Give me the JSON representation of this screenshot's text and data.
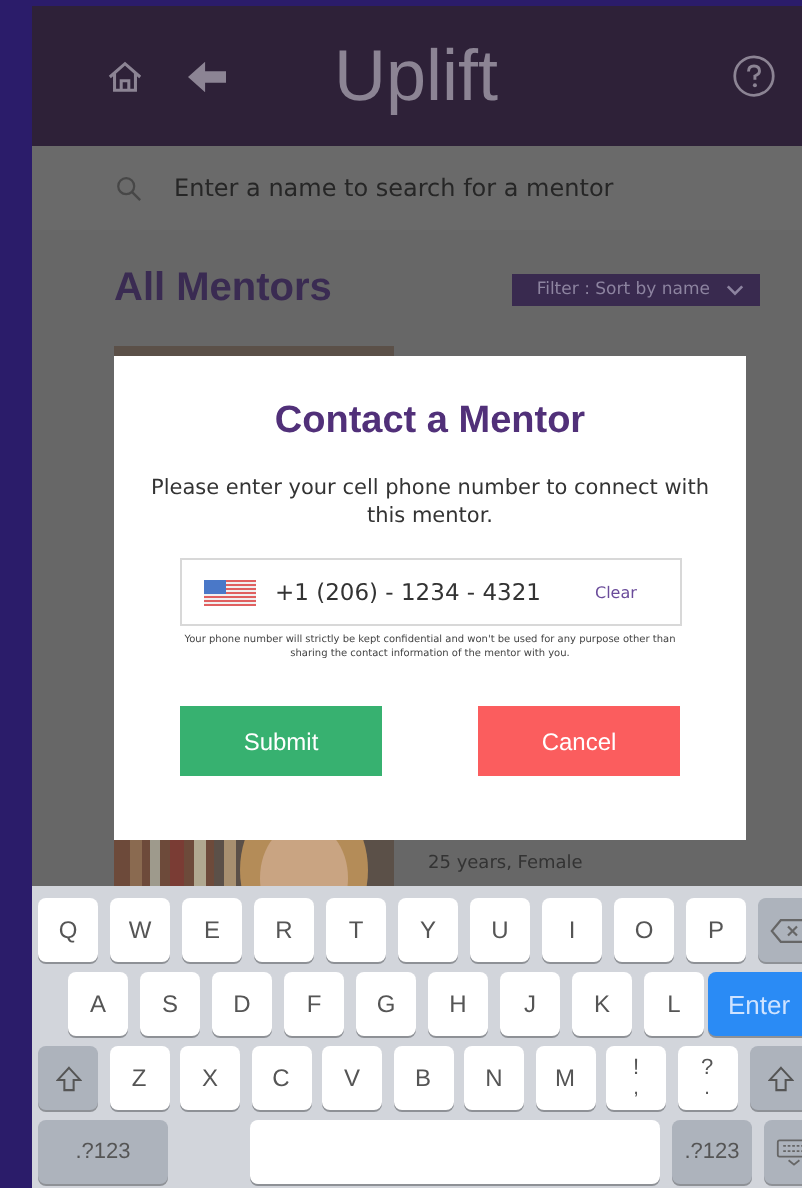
{
  "header": {
    "title": "Uplift"
  },
  "search": {
    "placeholder": "Enter a name to search for a mentor"
  },
  "section": {
    "title": "All Mentors",
    "filter": "Filter : Sort by name"
  },
  "mentor_card": {
    "details": "25 years, Female"
  },
  "modal": {
    "title": "Contact a Mentor",
    "message": "Please enter your cell phone number to connect with this mentor.",
    "phone": {
      "value": "+1 (206) - 1234 - 4321",
      "clear": "Clear"
    },
    "disclaimer": "Your phone number will strictly be kept confidential and won't be used for any purpose other than sharing the contact information of the mentor with you.",
    "buttons": [
      {
        "label": "Submit",
        "kind": "submit"
      },
      {
        "label": "Cancel",
        "kind": "cancel"
      }
    ]
  },
  "keyboard": {
    "key_lines": [
      {
        "keys": [
          {
            "label": "Q",
            "kind": "letter"
          },
          {
            "label": "W",
            "kind": "letter"
          },
          {
            "label": "E",
            "kind": "letter"
          },
          {
            "label": "R",
            "kind": "letter"
          },
          {
            "label": "T",
            "kind": "letter"
          },
          {
            "label": "Y",
            "kind": "letter"
          },
          {
            "label": "U",
            "kind": "letter"
          },
          {
            "label": "I",
            "kind": "letter"
          },
          {
            "label": "O",
            "kind": "letter"
          },
          {
            "label": "P",
            "kind": "letter"
          },
          {
            "kind": "backspace"
          }
        ]
      },
      {
        "keys": [
          {
            "label": "A",
            "kind": "letter"
          },
          {
            "label": "S",
            "kind": "letter"
          },
          {
            "label": "D",
            "kind": "letter"
          },
          {
            "label": "F",
            "kind": "letter"
          },
          {
            "label": "G",
            "kind": "letter"
          },
          {
            "label": "H",
            "kind": "letter"
          },
          {
            "label": "J",
            "kind": "letter"
          },
          {
            "label": "K",
            "kind": "letter"
          },
          {
            "label": "L",
            "kind": "letter"
          },
          {
            "label": "Enter",
            "kind": "enter"
          }
        ]
      },
      {
        "keys": [
          {
            "kind": "shift"
          },
          {
            "label": "Z",
            "kind": "letter"
          },
          {
            "label": "X",
            "kind": "letter"
          },
          {
            "label": "C",
            "kind": "letter"
          },
          {
            "label": "V",
            "kind": "letter"
          },
          {
            "label": "B",
            "kind": "letter"
          },
          {
            "label": "N",
            "kind": "letter"
          },
          {
            "label": "M",
            "kind": "letter"
          },
          {
            "label": "!",
            "sub": ",",
            "kind": "symbol"
          },
          {
            "label": "?",
            "sub": ".",
            "kind": "symbol"
          },
          {
            "kind": "shift"
          }
        ]
      },
      {
        "keys": [
          {
            "label": ".?123",
            "kind": "mode"
          },
          {
            "kind": "space"
          },
          {
            "label": ".?123",
            "kind": "mode"
          },
          {
            "kind": "hide"
          }
        ]
      }
    ]
  }
}
